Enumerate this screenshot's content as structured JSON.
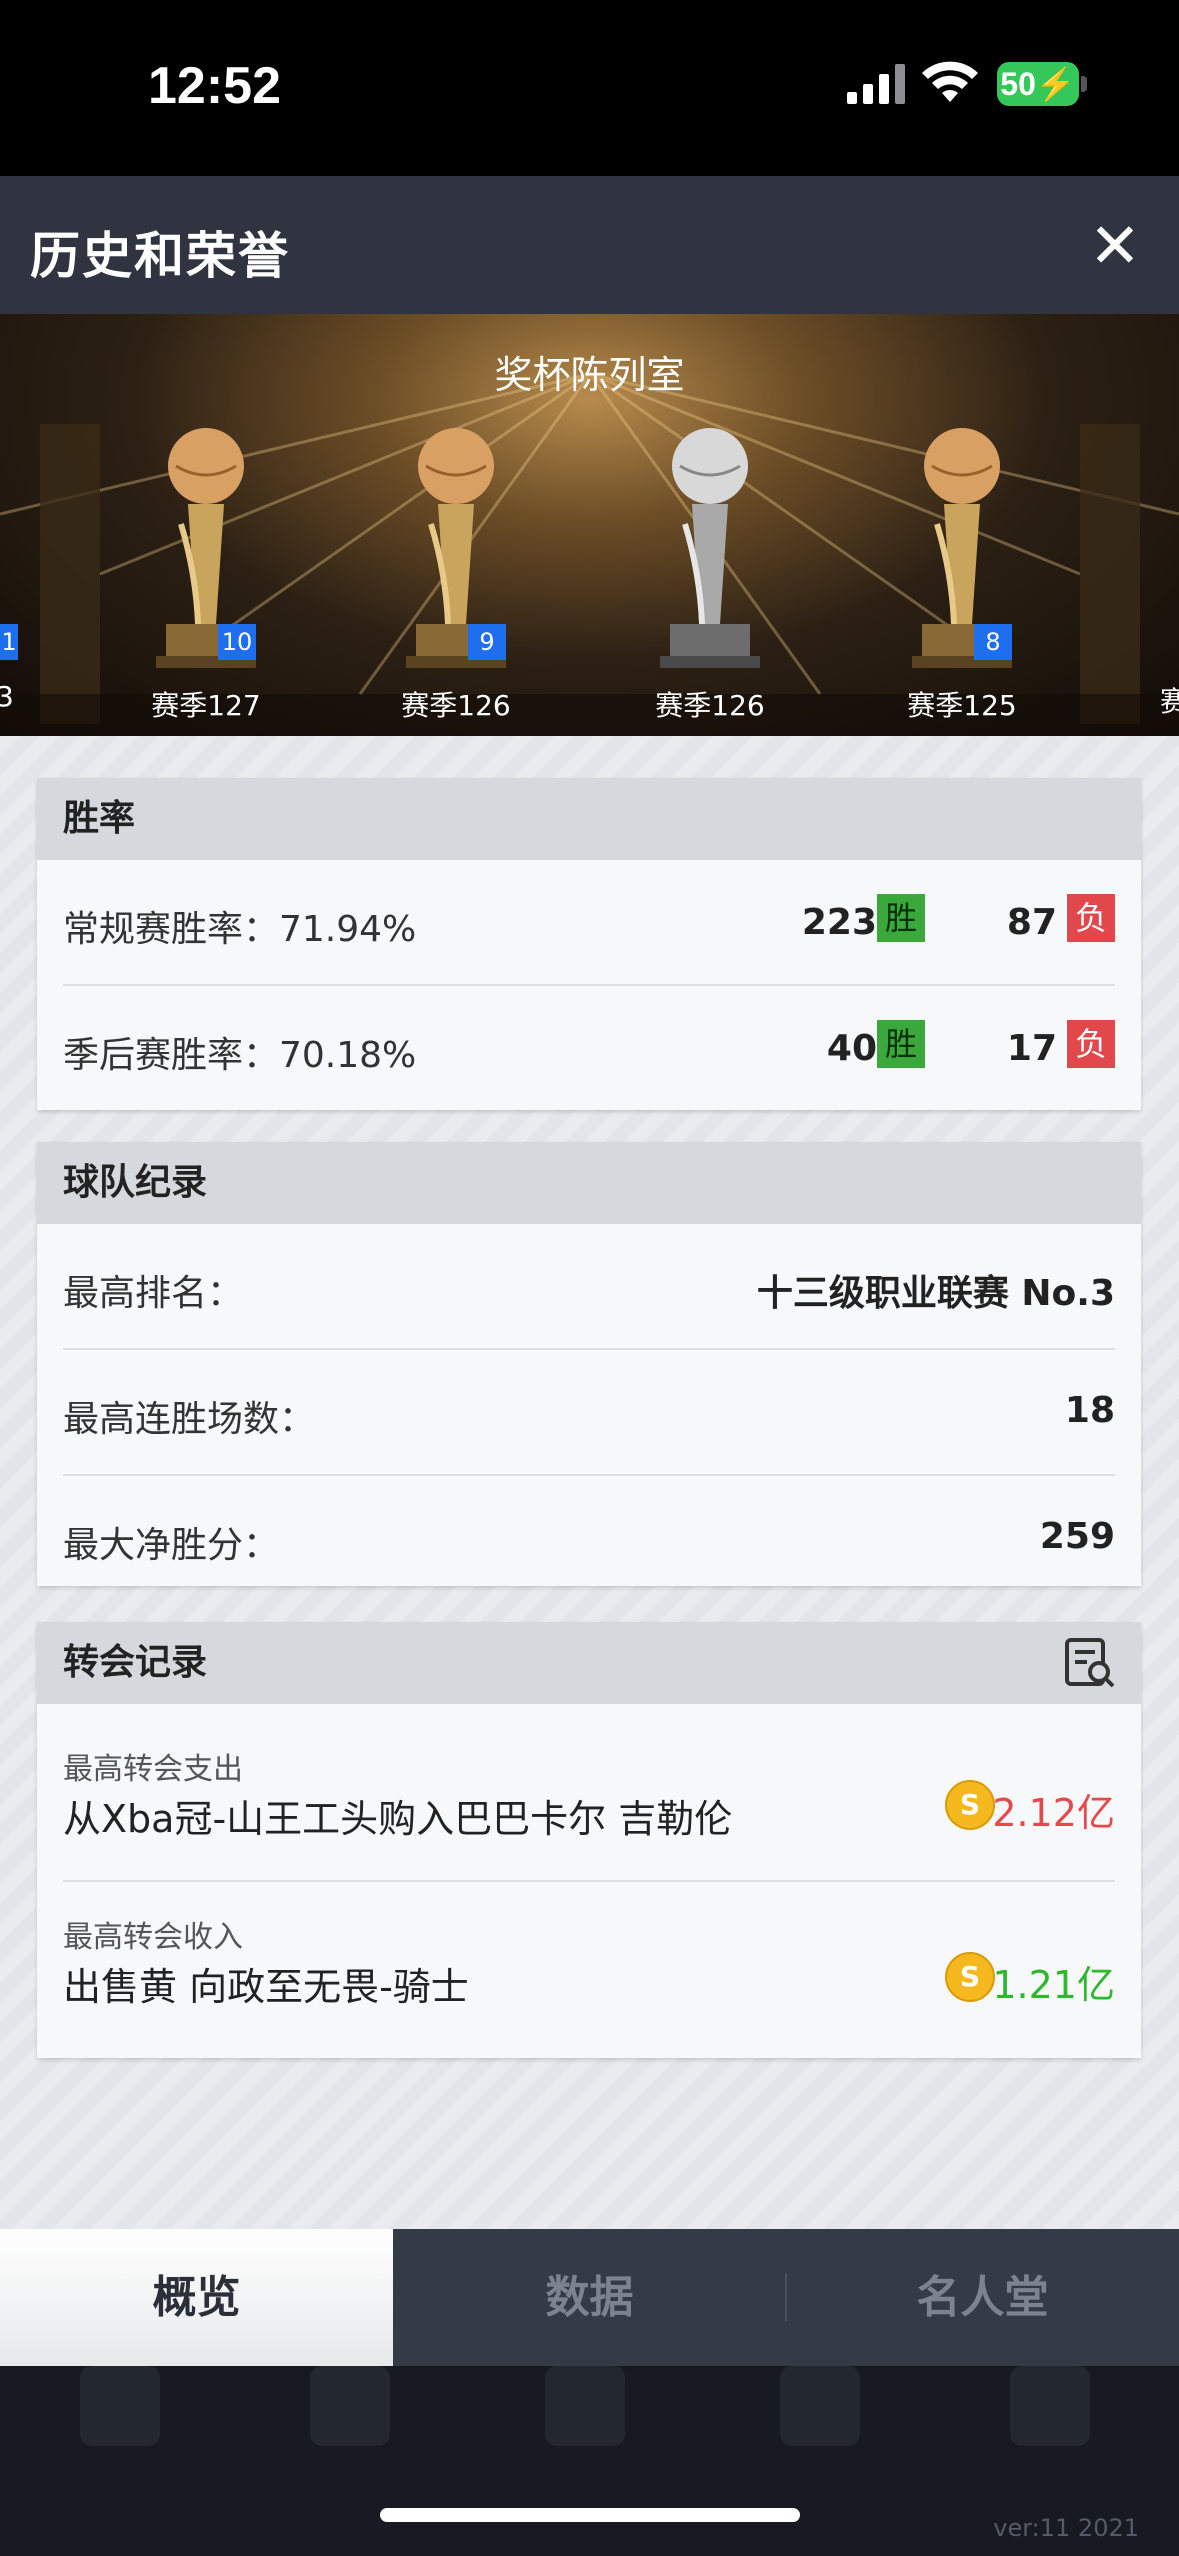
{
  "status": {
    "time": "12:52",
    "battery": "50"
  },
  "header": {
    "title": "历史和荣誉",
    "close": "✕"
  },
  "trophy_room": {
    "title": "奖杯陈列室",
    "left_partial": {
      "badge": "1",
      "season": "3"
    },
    "right_partial": {
      "season": "赛"
    },
    "trophies": [
      {
        "season": "赛季127",
        "badge": "10",
        "type": "gold"
      },
      {
        "season": "赛季126",
        "badge": "9",
        "type": "gold"
      },
      {
        "season": "赛季126",
        "badge": "",
        "type": "silver"
      },
      {
        "season": "赛季125",
        "badge": "8",
        "type": "gold"
      }
    ]
  },
  "win_rate": {
    "title": "胜率",
    "win_tag": "胜",
    "loss_tag": "负",
    "regular": {
      "label": "常规赛胜率：71.94%",
      "wins": "223",
      "losses": "87"
    },
    "playoff": {
      "label": "季后赛胜率：70.18%",
      "wins": "40",
      "losses": "17"
    }
  },
  "team_record": {
    "title": "球队纪录",
    "rows": [
      {
        "label": "最高排名：",
        "value": "十三级职业联赛 No.3"
      },
      {
        "label": "最高连胜场数：",
        "value": "18"
      },
      {
        "label": "最大净胜分：",
        "value": "259"
      }
    ]
  },
  "transfer_record": {
    "title": "转会记录",
    "coin_symbol": "S",
    "items": [
      {
        "caption": "最高转会支出",
        "desc": "从Xba冠-山王工头购入巴巴卡尔 吉勒伦",
        "amount": "2.12亿",
        "color": "#e5484d"
      },
      {
        "caption": "最高转会收入",
        "desc": "出售黄 向政至无畏-骑士",
        "amount": "1.21亿",
        "color": "#2eb82e"
      }
    ]
  },
  "tabs": [
    {
      "label": "概览",
      "active": true
    },
    {
      "label": "数据",
      "active": false
    },
    {
      "label": "名人堂",
      "active": false
    }
  ],
  "footer": {
    "version": "ver:11 2021"
  }
}
